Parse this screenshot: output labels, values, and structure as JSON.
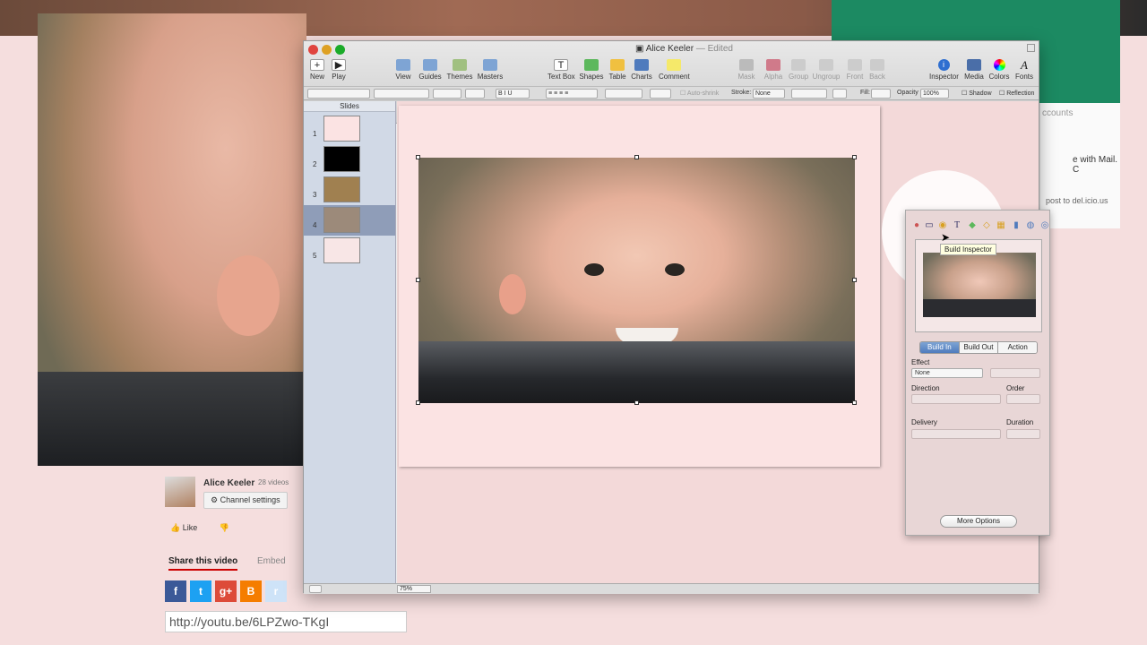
{
  "window": {
    "title": "Alice Keeler",
    "status": "— Edited"
  },
  "toolbar": {
    "new": "New",
    "play": "Play",
    "view": "View",
    "guides": "Guides",
    "themes": "Themes",
    "masters": "Masters",
    "text_box": "Text Box",
    "shapes": "Shapes",
    "table": "Table",
    "charts": "Charts",
    "comment": "Comment",
    "mask": "Mask",
    "alpha": "Alpha",
    "group": "Group",
    "ungroup": "Ungroup",
    "front": "Front",
    "back": "Back",
    "inspector": "Inspector",
    "media": "Media",
    "colors": "Colors",
    "fonts": "Fonts"
  },
  "formatbar": {
    "auto_shrink": "Auto-shrink",
    "stroke_label": "Stroke:",
    "stroke_value": "None",
    "fill_label": "Fill:",
    "opacity_label": "Opacity",
    "opacity_value": "100%",
    "shadow": "Shadow",
    "reflection": "Reflection"
  },
  "navigator": {
    "header": "Slides",
    "slides": [
      {
        "num": "1",
        "bg": "#fbe3e3"
      },
      {
        "num": "2",
        "bg": "#000000"
      },
      {
        "num": "3",
        "bg": "#a08050"
      },
      {
        "num": "4",
        "bg": "#9c8a7a"
      },
      {
        "num": "5",
        "bg": "#f8e6e6"
      }
    ]
  },
  "zoom": "75%",
  "inspector": {
    "tooltip": "Build Inspector",
    "tabs": [
      "Build In",
      "Build Out",
      "Action"
    ],
    "effect_label": "Effect",
    "effect_value": "None",
    "direction_label": "Direction",
    "order_label": "Order",
    "delivery_label": "Delivery",
    "duration_label": "Duration",
    "more_options": "More Options"
  },
  "background": {
    "right_panel": {
      "t1": "ccounts",
      "t2": "e with Mail. C",
      "t3": "post to del.icio.us"
    }
  },
  "youtube": {
    "channel_name": "Alice Keeler",
    "video_count": "28 videos",
    "channel_settings": "Channel settings",
    "like": "Like",
    "share": "Share this video",
    "embed": "Embed",
    "url": "http://youtu.be/6LPZwo-TKgI",
    "social": [
      {
        "label": "f",
        "color": "#3b5998"
      },
      {
        "label": "t",
        "color": "#1da1f2"
      },
      {
        "label": "g+",
        "color": "#dd4b39"
      },
      {
        "label": "B",
        "color": "#f57d00"
      },
      {
        "label": "r",
        "color": "#cee3f8"
      }
    ]
  }
}
